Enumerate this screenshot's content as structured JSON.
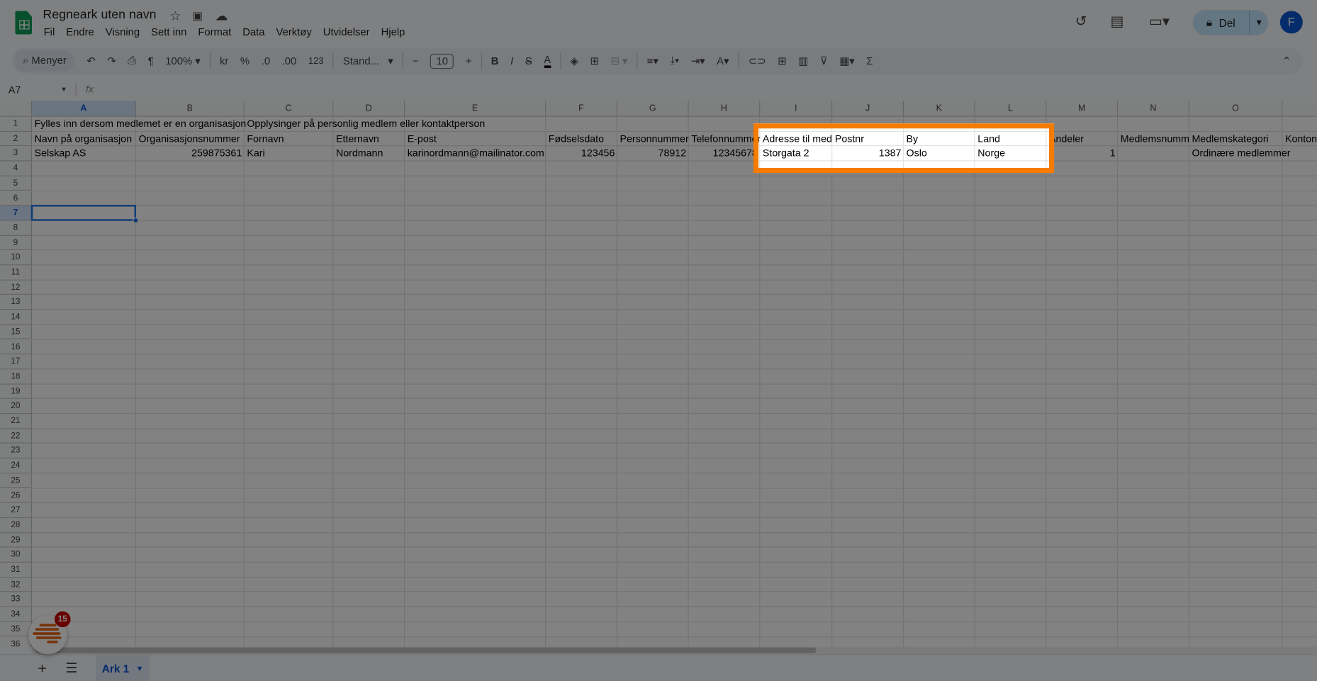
{
  "app": {
    "title": "Regneark uten navn"
  },
  "menu": [
    "Fil",
    "Endre",
    "Visning",
    "Sett inn",
    "Format",
    "Data",
    "Verktøy",
    "Utvidelser",
    "Hjelp"
  ],
  "header_actions": {
    "share_label": "Del",
    "avatar_letter": "F"
  },
  "toolbar": {
    "search_label": "Menyer",
    "zoom": "100%",
    "currency": "kr",
    "percent": "%",
    "dec_decrease": ".0",
    "dec_increase": ".00",
    "format_number": "123",
    "font": "Stand...",
    "font_size": "10",
    "bold": "B",
    "italic": "I",
    "text_color": "A"
  },
  "formula_bar": {
    "name_box": "A7",
    "fx": "fx",
    "value": ""
  },
  "columns": [
    "A",
    "B",
    "C",
    "D",
    "E",
    "F",
    "G",
    "H",
    "I",
    "J",
    "K",
    "L",
    "M",
    "N",
    "O"
  ],
  "selected_cell": "A7",
  "row_count": 36,
  "cells": [
    {
      "row": 1,
      "values": {
        "A": "Fylles inn dersom medlemet er en organisasjon",
        "C": "Opplysinger på personlig medlem eller kontaktperson"
      }
    },
    {
      "row": 2,
      "values": {
        "A": "Navn på organisasjon",
        "B": "Organisasjonsnummer",
        "C": "Fornavn",
        "D": "Etternavn",
        "E": "E-post",
        "F": "Fødselsdato",
        "G": "Personnummer",
        "H": "Telefonnummer",
        "I": "Adresse til medlem",
        "J": "Postnr",
        "K": "By",
        "L": "Land",
        "M": "Andeler",
        "N": "Medlemsnummer",
        "O": "Medlemskategori",
        "P": "Kontonummer"
      }
    },
    {
      "row": 3,
      "values": {
        "A": "Selskap AS",
        "B": "259875361",
        "C": "Kari",
        "D": "Nordmann",
        "E": "karinordmann@mailinator.com",
        "F": "123456",
        "G": "78912",
        "H": "12345678",
        "I": "Storgata 2",
        "J": "1387",
        "K": "Oslo",
        "L": "Norge",
        "M": "1",
        "O": "Ordinære medlemmer"
      }
    }
  ],
  "sheets": [
    {
      "label": "Ark 1",
      "active": true
    }
  ],
  "extension_badge": "15",
  "colors": {
    "highlight": "#f57c00",
    "accent": "#0b57d0",
    "sheets_green": "#0f9d58"
  }
}
